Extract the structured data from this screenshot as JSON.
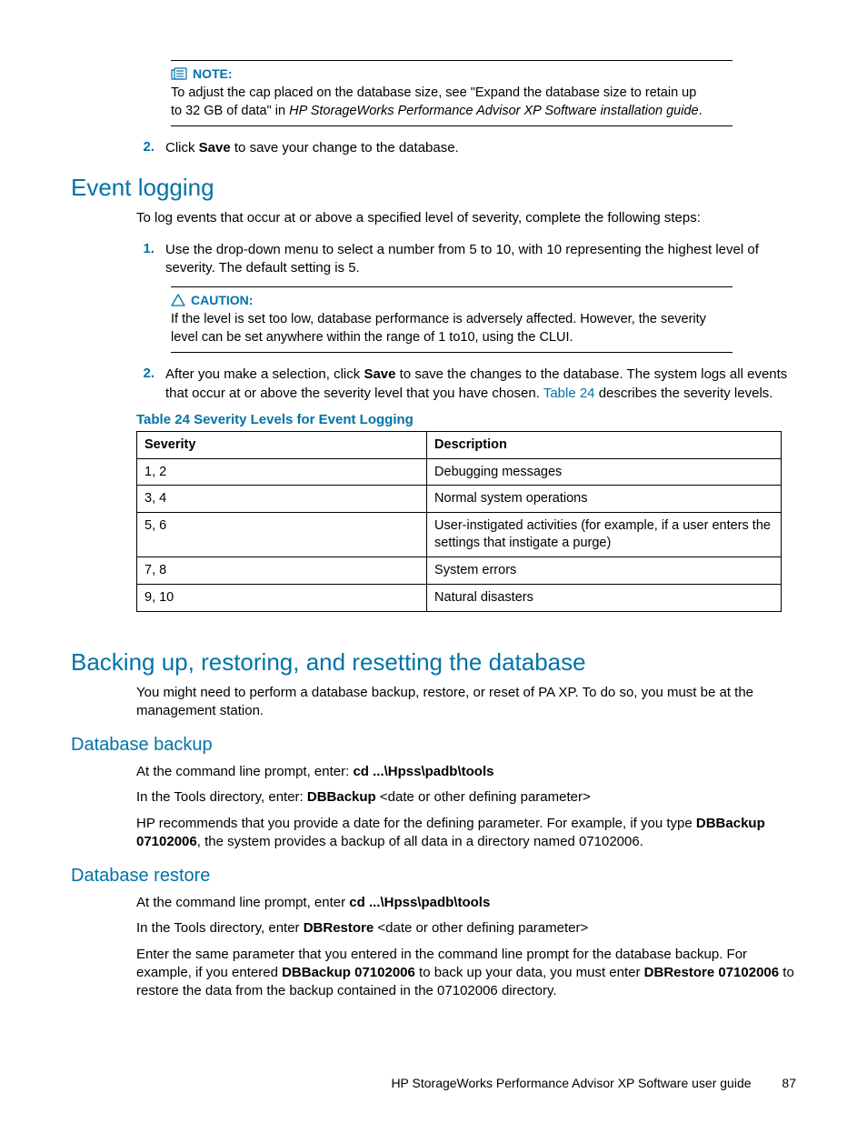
{
  "note1": {
    "label": "NOTE:",
    "line1_a": "To adjust the cap placed on the database size, see \"Expand the database size to retain up",
    "line1_b": "to 32 GB of data\" in ",
    "line1_c": "HP StorageWorks Performance Advisor XP Software installation guide",
    "line1_d": "."
  },
  "step2a": {
    "num": "2.",
    "pre": "Click ",
    "bold": "Save",
    "post": " to save your change to the database."
  },
  "h_eventlogging": "Event logging",
  "el_intro": "To log events that occur at or above a specified level of severity, complete the following steps:",
  "el_step1": {
    "num": "1.",
    "text": "Use the drop-down menu to select a number from 5 to 10, with 10 representing the highest level of severity.  The default setting is 5."
  },
  "caution": {
    "label": "CAUTION:",
    "text": "If the level is set too low, database performance is adversely affected. However, the severity level can be set anywhere within the range of 1 to10, using the CLUI."
  },
  "el_step2": {
    "num": "2.",
    "pre": "After you make a selection, click ",
    "bold": "Save",
    "mid": " to save the changes to the database.  The system logs all events that occur at or above the severity level that you have chosen.  ",
    "link": "Table 24",
    "post": " describes the severity levels."
  },
  "table": {
    "title": "Table 24 Severity Levels for Event Logging",
    "h1": "Severity",
    "h2": "Description",
    "rows": [
      {
        "sev": "1, 2",
        "desc": "Debugging messages"
      },
      {
        "sev": "3, 4",
        "desc": "Normal system operations"
      },
      {
        "sev": "5, 6",
        "desc": "User-instigated activities (for example, if a user enters the settings that instigate a purge)"
      },
      {
        "sev": "7, 8",
        "desc": "System errors"
      },
      {
        "sev": "9, 10",
        "desc": "Natural disasters"
      }
    ]
  },
  "h_backup": "Backing up, restoring, and resetting the database",
  "backup_intro": "You might need to perform a database backup, restore, or reset of PA XP. To do so, you must be at the management station.",
  "h_dbbackup": "Database backup",
  "db_b1": {
    "pre": "At the command line prompt, enter: ",
    "bold": "cd ...\\Hpss\\padb\\tools"
  },
  "db_b2": {
    "pre": "In the Tools directory, enter: ",
    "bold": "DBBackup ",
    "italic": "<date or other defining parameter>"
  },
  "db_b3": {
    "pre": "HP recommends that you provide a date for the defining parameter.  For example, if you type ",
    "bold1": "DBBackup 07102006",
    "post": ", the system provides a backup of all data in a directory named 07102006."
  },
  "h_dbrestore": "Database restore",
  "db_r1": {
    "pre": "At the command line prompt, enter ",
    "bold": "cd ...\\Hpss\\padb\\tools"
  },
  "db_r2": {
    "pre": "In the Tools directory, enter ",
    "bold": "DBRestore ",
    "italic": "<date or other defining parameter>"
  },
  "db_r3": {
    "pre": "Enter the same parameter that you entered in the command line prompt for the database backup.  For example, if you entered ",
    "bold1": "DBBackup 07102006",
    "mid": " to back up your data, you must enter ",
    "bold2": "DBRestore 07102006",
    "post": " to restore the data from the backup contained in the 07102006 directory."
  },
  "footer": {
    "text": "HP StorageWorks Performance Advisor XP Software user guide",
    "page": "87"
  }
}
